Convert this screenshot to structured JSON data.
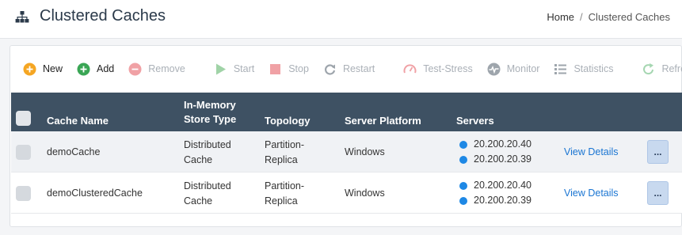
{
  "header": {
    "title": "Clustered Caches",
    "title_icon": "sitemap-icon",
    "breadcrumb": {
      "home": "Home",
      "separator": "/",
      "current": "Clustered Caches"
    }
  },
  "toolbar": {
    "buttons": [
      {
        "label": "New",
        "icon": "plus-circle-orange-icon",
        "enabled": true
      },
      {
        "label": "Add",
        "icon": "plus-circle-green-icon",
        "enabled": true
      },
      {
        "label": "Remove",
        "icon": "minus-circle-icon",
        "enabled": false
      },
      {
        "label": "Start",
        "icon": "play-icon",
        "enabled": false
      },
      {
        "label": "Stop",
        "icon": "stop-icon",
        "enabled": false
      },
      {
        "label": "Restart",
        "icon": "restart-icon",
        "enabled": false
      },
      {
        "label": "Test-Stress",
        "icon": "gauge-icon",
        "enabled": false
      },
      {
        "label": "Monitor",
        "icon": "pulse-icon",
        "enabled": false
      },
      {
        "label": "Statistics",
        "icon": "list-icon",
        "enabled": false
      },
      {
        "label": "Refresh",
        "icon": "refresh-icon",
        "enabled": false
      }
    ]
  },
  "table": {
    "columns": {
      "name": "Cache Name",
      "store_type_line1": "In-Memory",
      "store_type_line2": "Store Type",
      "topology": "Topology",
      "platform": "Server Platform",
      "servers": "Servers"
    },
    "rows": [
      {
        "name": "demoCache",
        "store_type_line1": "Distributed",
        "store_type_line2": "Cache",
        "topology_line1": "Partition-",
        "topology_line2": "Replica",
        "platform": "Windows",
        "servers": [
          "20.200.20.40",
          "20.200.20.39"
        ],
        "details": "View Details",
        "more": "..."
      },
      {
        "name": "demoClusteredCache",
        "store_type_line1": "Distributed",
        "store_type_line2": "Cache",
        "topology_line1": "Partition-",
        "topology_line2": "Replica",
        "platform": "Windows",
        "servers": [
          "20.200.20.40",
          "20.200.20.39"
        ],
        "details": "View Details",
        "more": "..."
      }
    ]
  },
  "colors": {
    "table_header": "#3e5163",
    "server_dot": "#1e88e5",
    "link": "#1a75d2"
  }
}
